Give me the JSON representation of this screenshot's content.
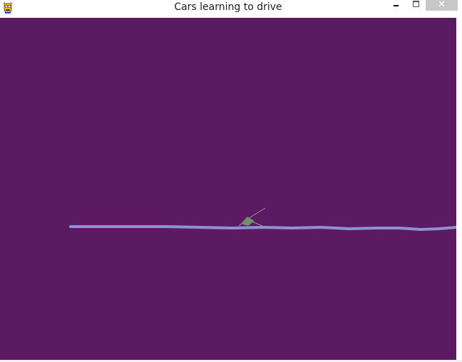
{
  "window": {
    "title": "Cars learning to drive",
    "app_icon": "pygame-snake-icon",
    "controls": {
      "minimize_icon": "minimize-icon",
      "maximize_icon": "maximize-icon",
      "close_icon": "close-icon",
      "close_glyph": "✕"
    }
  },
  "game": {
    "background_color": "#5b1a62",
    "track_color": "#8c92d4",
    "car_color": "#6e8f70",
    "sensor_color": "#9a9a9a"
  }
}
